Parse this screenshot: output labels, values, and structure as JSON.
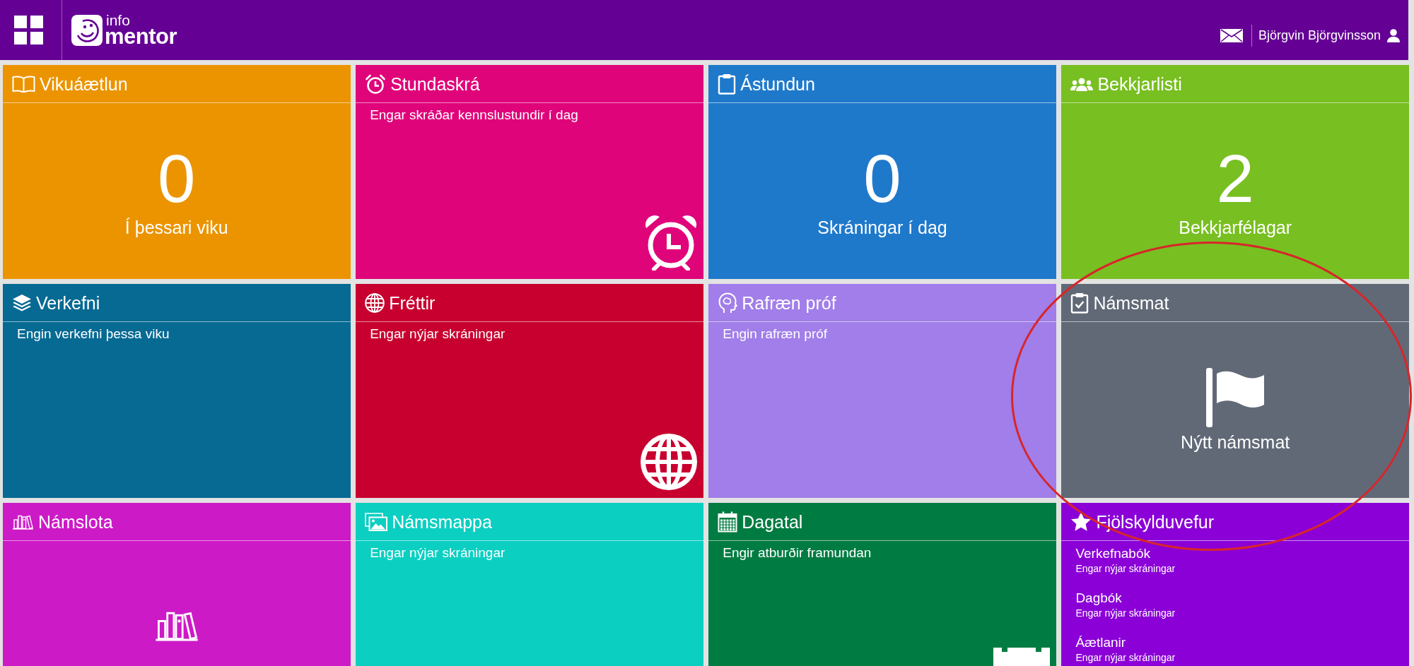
{
  "header": {
    "logo": {
      "top": "info",
      "bottom": "mentor"
    },
    "user_name": "Björgvin Björgvinsson"
  },
  "tiles": [
    {
      "kind": "count",
      "title": "Vikuáætlun",
      "color": "#eb9400",
      "value": "0",
      "caption": "Í þessari viku",
      "circled": false
    },
    {
      "kind": "message",
      "title": "Stundaskrá",
      "color": "#e0047a",
      "message": "Engar skráðar kennslustundir í dag",
      "circled": false
    },
    {
      "kind": "count",
      "title": "Ástundun",
      "color": "#1f79cb",
      "value": "0",
      "caption": "Skráningar í dag",
      "circled": false
    },
    {
      "kind": "count",
      "title": "Bekkjarlisti",
      "color": "#78bf21",
      "value": "2",
      "caption": "Bekkjarfélagar",
      "circled": false
    },
    {
      "kind": "message",
      "title": "Verkefni",
      "color": "#066a93",
      "message": "Engin verkefni þessa viku",
      "circled": false
    },
    {
      "kind": "message",
      "title": "Fréttir",
      "color": "#c8002f",
      "message": "Engar nýjar skráningar",
      "circled": false
    },
    {
      "kind": "message",
      "title": "Rafræn próf",
      "color": "#a17ee9",
      "message": "Engin rafræn próf",
      "circled": false
    },
    {
      "kind": "action",
      "title": "Námsmat",
      "color": "#616977",
      "caption": "Nýtt námsmat",
      "circled": true
    },
    {
      "kind": "icon",
      "title": "Námslota",
      "color": "#cd1ac7",
      "circled": false
    },
    {
      "kind": "message",
      "title": "Námsmappa",
      "color": "#0bcfc1",
      "message": "Engar nýjar skráningar",
      "circled": false
    },
    {
      "kind": "message",
      "title": "Dagatal",
      "color": "#007c42",
      "message": "Engir atburðir framundan",
      "circled": false
    },
    {
      "kind": "list",
      "title": "Fjölskylduvefur",
      "color": "#8b00d7",
      "items": [
        {
          "title": "Verkefnabók",
          "status": "Engar nýjar skráningar"
        },
        {
          "title": "Dagbók",
          "status": "Engar nýjar skráningar"
        },
        {
          "title": "Áætlanir",
          "status": "Engar nýjar skráningar"
        }
      ],
      "circled": false
    }
  ]
}
